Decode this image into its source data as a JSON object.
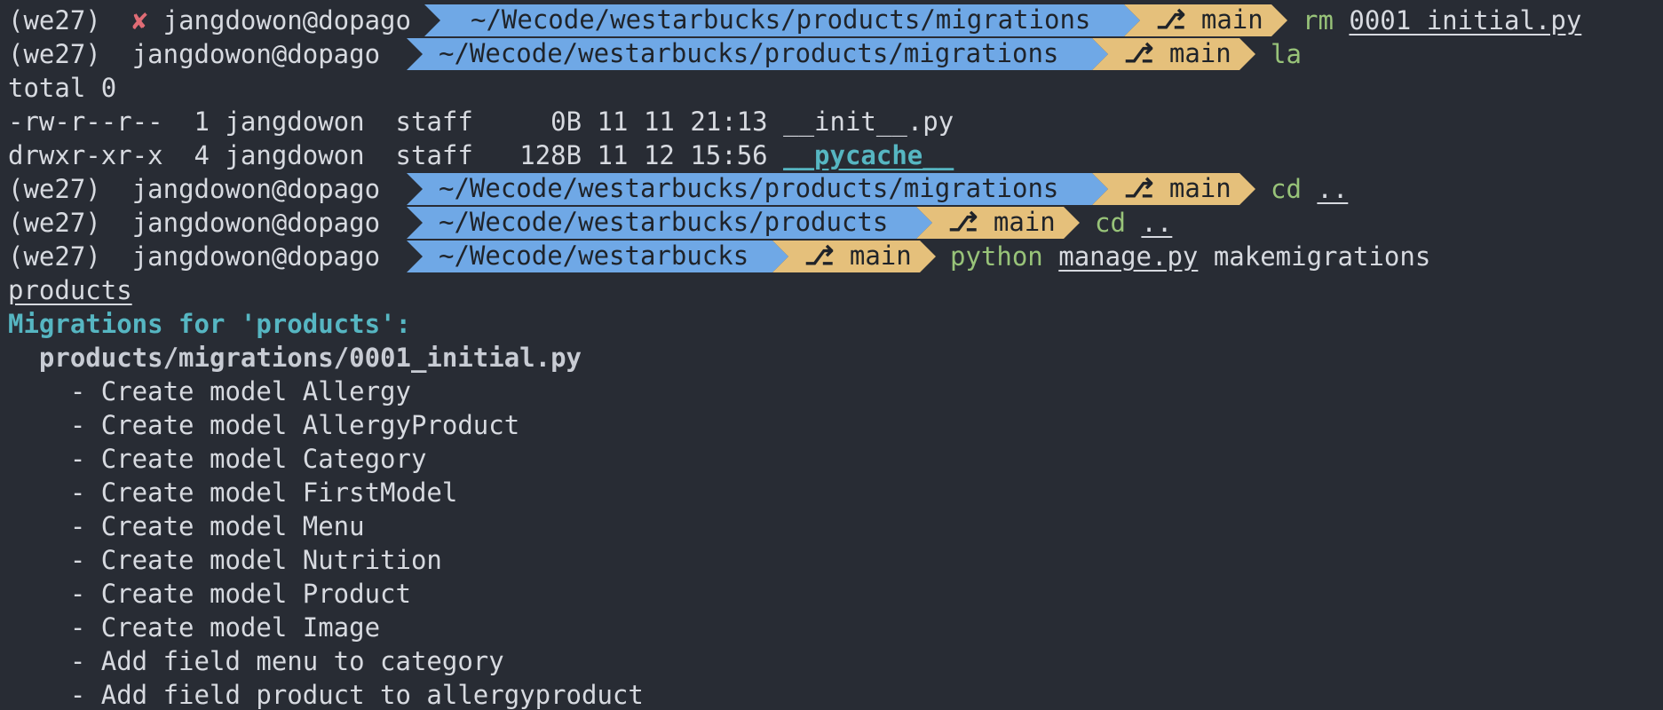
{
  "colors": {
    "background": "#282c34",
    "path_segment": "#6fa8e6",
    "git_segment": "#e5c07b",
    "command": "#98c379",
    "error_mark": "#e06c75",
    "heading": "#56b6c2"
  },
  "icons": {
    "error": "cross-mark-icon",
    "git_branch": "git-branch-icon"
  },
  "prompts": [
    {
      "env": "(we27)",
      "status": "✘",
      "user": "jangdowon@dopago",
      "path": "~/Wecode/westarbucks/products/migrations",
      "branch_icon": "⎇",
      "branch": "main",
      "command": "rm",
      "arg1": "0001_initial.py",
      "arg2": ""
    },
    {
      "env": "(we27)",
      "status": "",
      "user": "jangdowon@dopago",
      "path": "~/Wecode/westarbucks/products/migrations",
      "branch_icon": "⎇",
      "branch": "main",
      "command": "la",
      "arg1": "",
      "arg2": ""
    },
    {
      "env": "(we27)",
      "status": "",
      "user": "jangdowon@dopago",
      "path": "~/Wecode/westarbucks/products/migrations",
      "branch_icon": "⎇",
      "branch": "main",
      "command": "cd",
      "arg1": "..",
      "arg2": ""
    },
    {
      "env": "(we27)",
      "status": "",
      "user": "jangdowon@dopago",
      "path": "~/Wecode/westarbucks/products",
      "branch_icon": "⎇",
      "branch": "main",
      "command": "cd",
      "arg1": "..",
      "arg2": ""
    },
    {
      "env": "(we27)",
      "status": "",
      "user": "jangdowon@dopago",
      "path": "~/Wecode/westarbucks",
      "branch_icon": "⎇",
      "branch": "main",
      "command": "python",
      "arg1": "manage.py",
      "arg2": "makemigrations"
    }
  ],
  "listing": {
    "total": "total 0",
    "files": [
      {
        "perms": "-rw-r--r--",
        "links": "1",
        "owner": "jangdowon",
        "group": "staff",
        "size": "0B",
        "month": "11",
        "day": "11",
        "time": "21:13",
        "name": "__init__.py"
      },
      {
        "perms": "drwxr-xr-x",
        "links": "4",
        "owner": "jangdowon",
        "group": "staff",
        "size": "128B",
        "month": "11",
        "day": "12",
        "time": "15:56",
        "name": "__pycache__"
      }
    ]
  },
  "output": {
    "app_arg": "products",
    "heading": "Migrations for 'products':",
    "file": "products/migrations/0001_initial.py",
    "operations": [
      "- Create model Allergy",
      "- Create model AllergyProduct",
      "- Create model Category",
      "- Create model FirstModel",
      "- Create model Menu",
      "- Create model Nutrition",
      "- Create model Product",
      "- Create model Image",
      "- Add field menu to category",
      "- Add field product to allergyproduct"
    ]
  }
}
